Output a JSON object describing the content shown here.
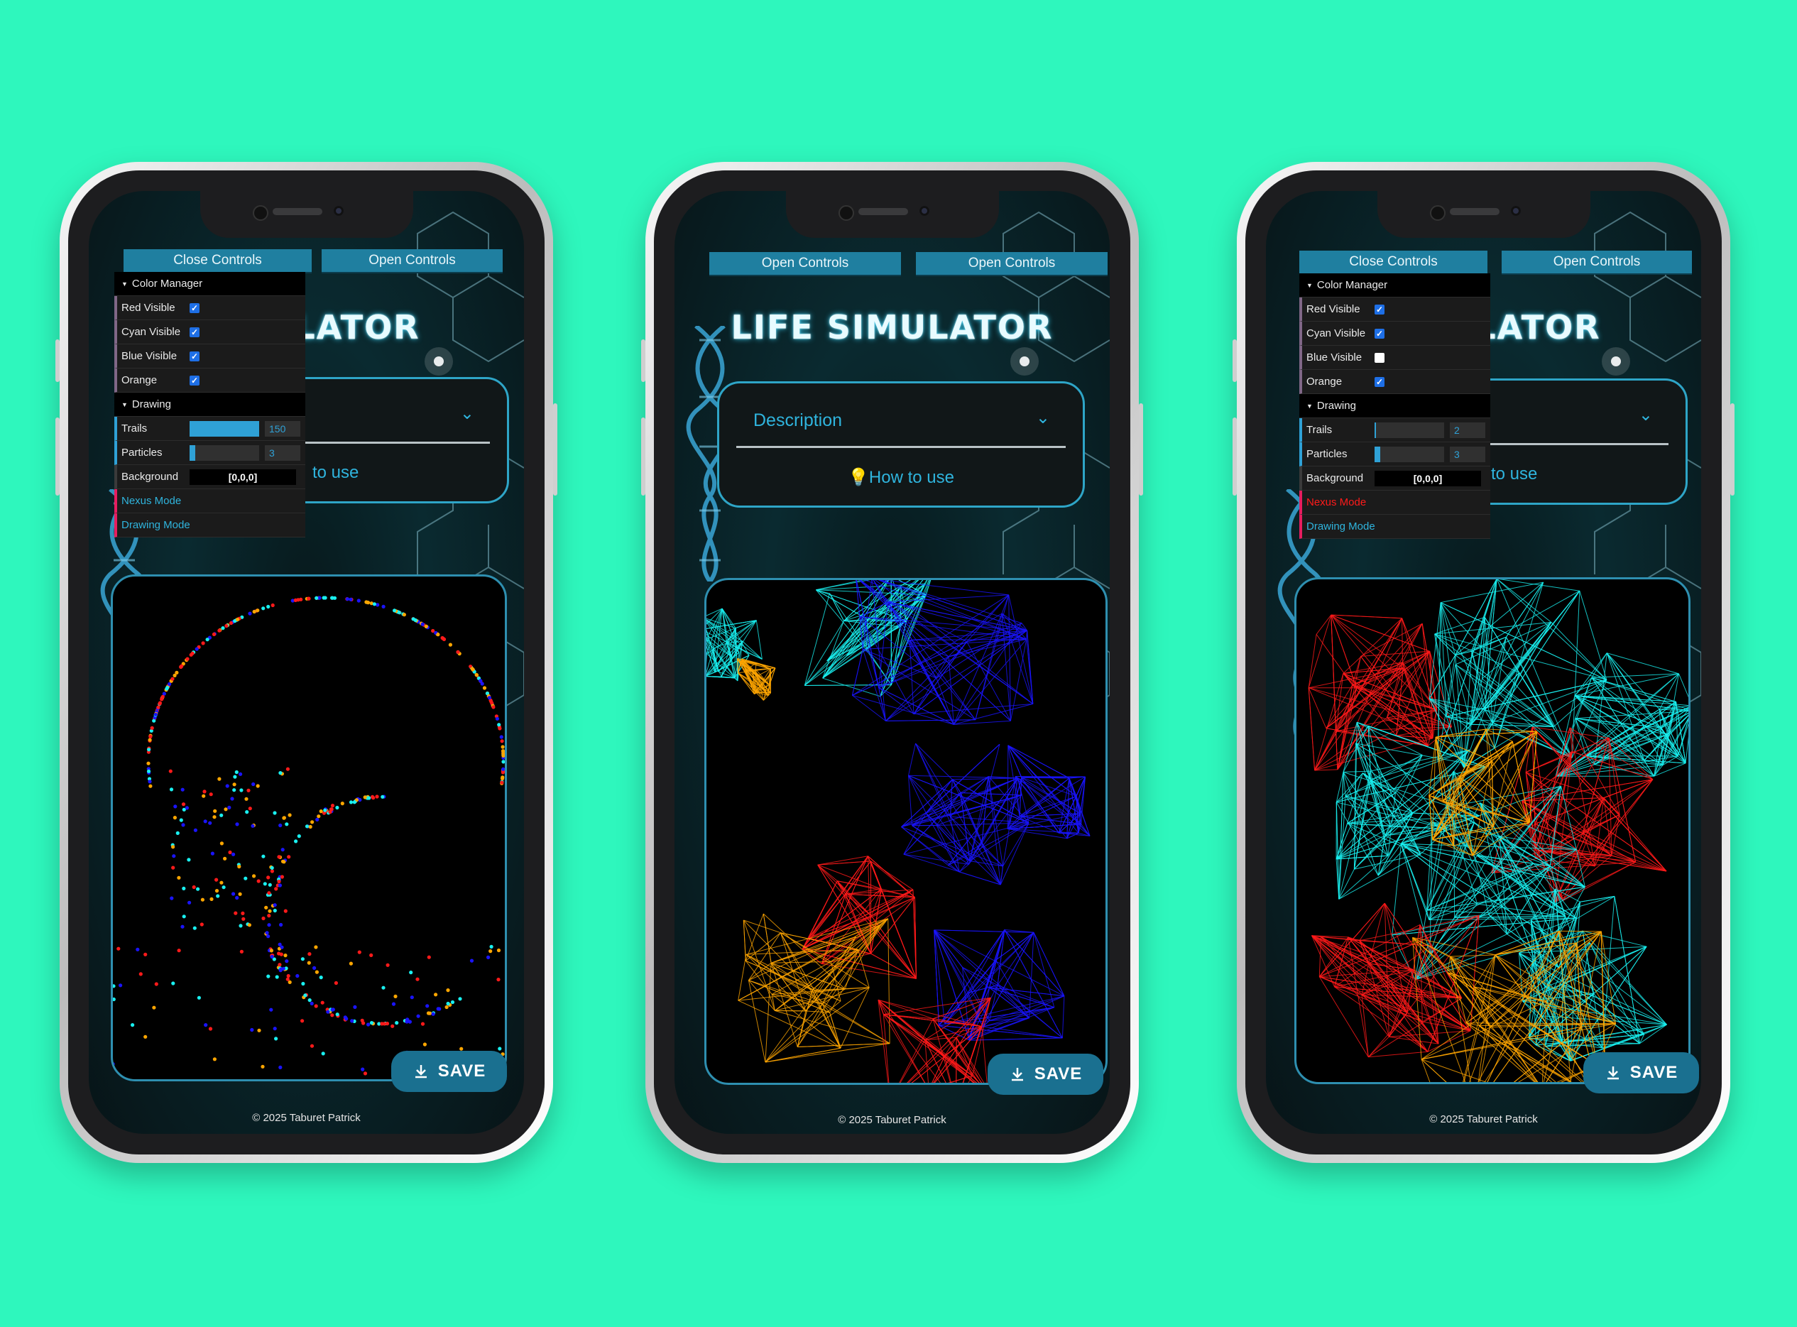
{
  "brand_colors": {
    "page_bg": "#2ef7bd",
    "accent": "#2fb4dd",
    "button": "#1f7fa0",
    "red": "#ff1a1a",
    "cyan": "#19f0f0",
    "blue": "#1a14ff",
    "orange": "#ffa600"
  },
  "phones": [
    {
      "buttons": {
        "left": "Close Controls",
        "right": "Open Controls"
      },
      "title": "ULATOR",
      "description": {
        "label": "",
        "how_to_use": "to use"
      },
      "gui": {
        "color_manager": "Color Manager",
        "red": {
          "label": "Red Visible",
          "checked": true
        },
        "cyan": {
          "label": "Cyan Visible",
          "checked": true
        },
        "blue": {
          "label": "Blue Visible",
          "checked": true
        },
        "orange": {
          "label": "Orange",
          "checked": true
        },
        "drawing": "Drawing",
        "trails": {
          "label": "Trails",
          "value": "150",
          "fraction": 1.0
        },
        "particles": {
          "label": "Particles",
          "value": "3",
          "fraction": 0.08
        },
        "background": {
          "label": "Background",
          "value": "[0,0,0]"
        },
        "nexus_mode": {
          "label": "Nexus Mode",
          "color": "#2fb4dd"
        },
        "drawing_mode": {
          "label": "Drawing Mode",
          "color": "#2fb4dd"
        }
      },
      "save": "SAVE",
      "copyright": "© 2025 Taburet Patrick"
    },
    {
      "buttons": {
        "left": "Open Controls",
        "right": "Open Controls"
      },
      "title": "LIFE SIMULATOR",
      "description": {
        "label": "Description",
        "how_to_use": "How to use"
      },
      "save": "SAVE",
      "copyright": "© 2025 Taburet Patrick"
    },
    {
      "buttons": {
        "left": "Close Controls",
        "right": "Open Controls"
      },
      "title": "ULATOR",
      "description": {
        "label": "",
        "how_to_use": "to use"
      },
      "gui": {
        "color_manager": "Color Manager",
        "red": {
          "label": "Red Visible",
          "checked": true
        },
        "cyan": {
          "label": "Cyan Visible",
          "checked": true
        },
        "blue": {
          "label": "Blue Visible",
          "checked": false
        },
        "orange": {
          "label": "Orange",
          "checked": true
        },
        "drawing": "Drawing",
        "trails": {
          "label": "Trails",
          "value": "2",
          "fraction": 0.01
        },
        "particles": {
          "label": "Particles",
          "value": "3",
          "fraction": 0.08
        },
        "background": {
          "label": "Background",
          "value": "[0,0,0]"
        },
        "nexus_mode": {
          "label": "Nexus Mode",
          "color": "#ff1a1a"
        },
        "drawing_mode": {
          "label": "Drawing Mode",
          "color": "#2fb4dd"
        }
      },
      "save": "SAVE",
      "copyright": "© 2025 Taburet Patrick"
    }
  ],
  "icons": {
    "save": "download-icon",
    "chevron": "chevron-down-icon",
    "bulb": "lightbulb-icon"
  }
}
